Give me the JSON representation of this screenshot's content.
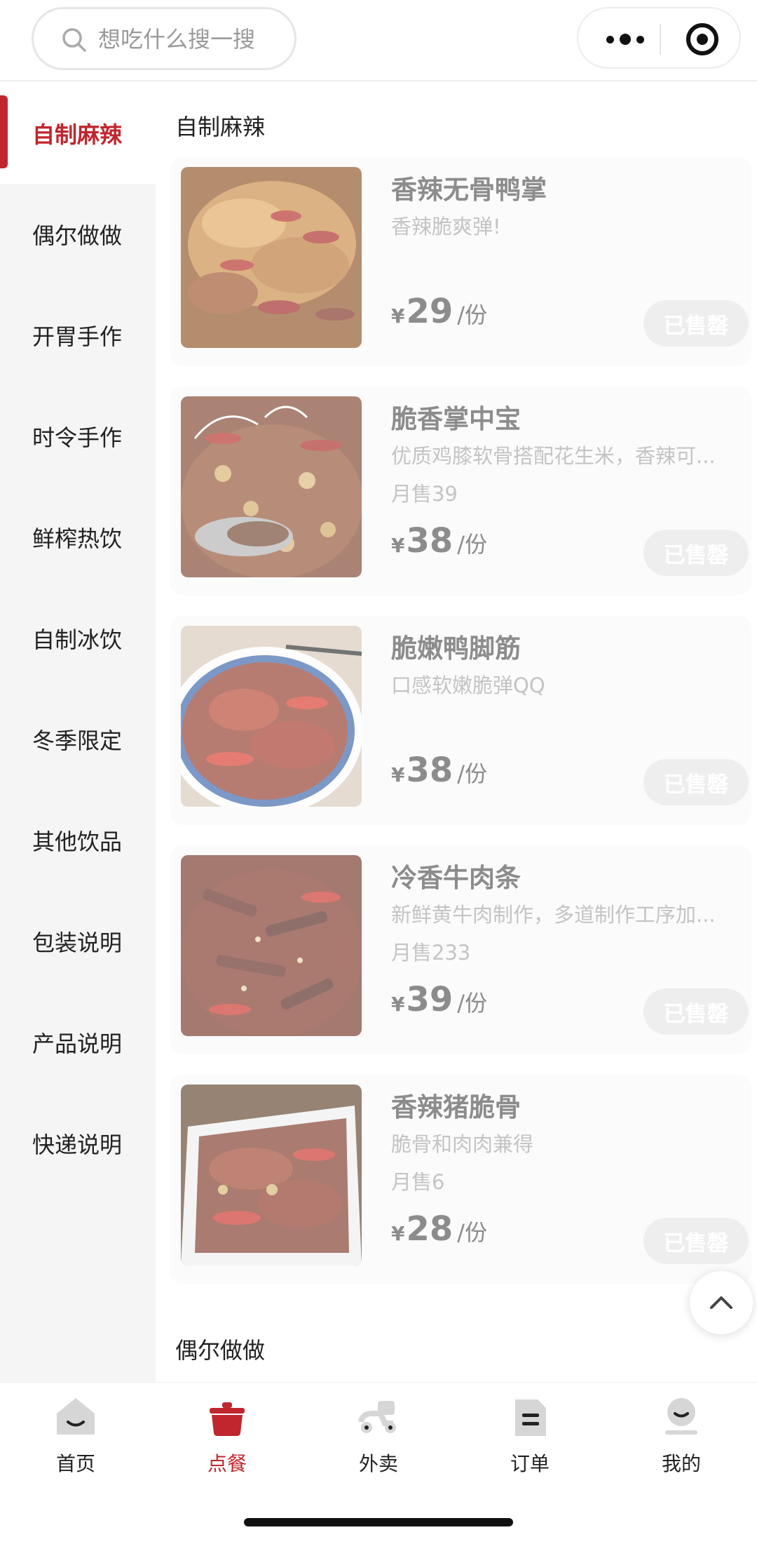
{
  "header": {
    "search_placeholder": "想吃什么搜一搜",
    "more_icon": "more-dots-icon",
    "capsule_icon": "target-close-icon"
  },
  "sidebar": {
    "active_color": "#c0262e",
    "items": [
      {
        "label": "自制麻辣",
        "active": true
      },
      {
        "label": "偶尔做做",
        "active": false
      },
      {
        "label": "开胃手作",
        "active": false
      },
      {
        "label": "时令手作",
        "active": false
      },
      {
        "label": "鲜榨热饮",
        "active": false
      },
      {
        "label": "自制冰饮",
        "active": false
      },
      {
        "label": "冬季限定",
        "active": false
      },
      {
        "label": "其他饮品",
        "active": false
      },
      {
        "label": "包装说明",
        "active": false
      },
      {
        "label": "产品说明",
        "active": false
      },
      {
        "label": "快递说明",
        "active": false
      }
    ]
  },
  "main": {
    "section_title": "自制麻辣",
    "next_section_title": "偶尔做做",
    "products": [
      {
        "name": "香辣无骨鸭掌",
        "desc": "香辣脆爽弹!",
        "sales": "",
        "currency": "¥",
        "price": "29",
        "unit": "/份",
        "status": "已售罄"
      },
      {
        "name": "脆香掌中宝",
        "desc": "优质鸡膝软骨搭配花生米，香辣可...",
        "sales": "月售39",
        "currency": "¥",
        "price": "38",
        "unit": "/份",
        "status": "已售罄"
      },
      {
        "name": "脆嫩鸭脚筋",
        "desc": "口感软嫩脆弹QQ",
        "sales": "",
        "currency": "¥",
        "price": "38",
        "unit": "/份",
        "status": "已售罄"
      },
      {
        "name": "冷香牛肉条",
        "desc": "新鲜黄牛肉制作，多道制作工序加...",
        "sales": "月售233",
        "currency": "¥",
        "price": "39",
        "unit": "/份",
        "status": "已售罄"
      },
      {
        "name": "香辣猪脆骨",
        "desc": "脆骨和肉肉兼得",
        "sales": "月售6",
        "currency": "¥",
        "price": "28",
        "unit": "/份",
        "status": "已售罄"
      }
    ]
  },
  "tabbar": {
    "active_color": "#c0262e",
    "tabs": [
      {
        "label": "首页",
        "icon": "home-icon",
        "active": false
      },
      {
        "label": "点餐",
        "icon": "pot-icon",
        "active": true
      },
      {
        "label": "外卖",
        "icon": "scooter-icon",
        "active": false
      },
      {
        "label": "订单",
        "icon": "order-icon",
        "active": false
      },
      {
        "label": "我的",
        "icon": "profile-icon",
        "active": false
      }
    ]
  }
}
